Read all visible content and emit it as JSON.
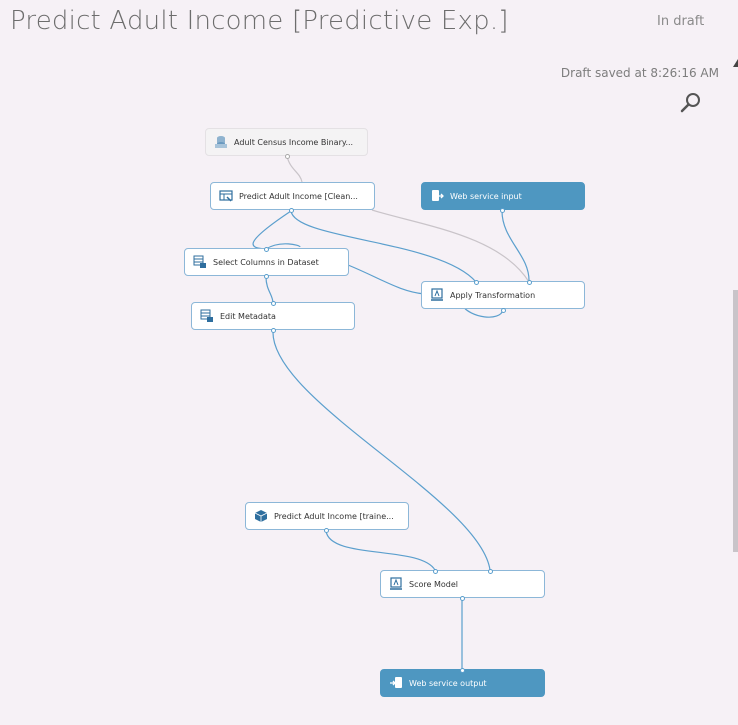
{
  "header": {
    "title": "Predict Adult Income [Predictive Exp.]",
    "status": "In draft",
    "saved_text": "Draft saved at 8:26:16 AM"
  },
  "modules": {
    "census": {
      "label": "Adult Census Income Binary...",
      "icon": "dataset-icon"
    },
    "clean": {
      "label": "Predict Adult Income [Clean...",
      "icon": "transform-icon"
    },
    "ws_input": {
      "label": "Web service input",
      "icon": "web-service-input-icon"
    },
    "select": {
      "label": "Select Columns in Dataset",
      "icon": "table-icon"
    },
    "apply": {
      "label": "Apply Transformation",
      "icon": "score-icon"
    },
    "edit": {
      "label": "Edit Metadata",
      "icon": "table-icon"
    },
    "trained": {
      "label": "Predict Adult Income [traine...",
      "icon": "cube-icon"
    },
    "score": {
      "label": "Score Model",
      "icon": "score-icon"
    },
    "ws_output": {
      "label": "Web service output",
      "icon": "web-service-output-icon"
    }
  },
  "colors": {
    "background": "#f6f1f6",
    "connector": "#5b9fcd",
    "service_module": "#4e97c1",
    "gray_connector": "#c9c4c9"
  }
}
